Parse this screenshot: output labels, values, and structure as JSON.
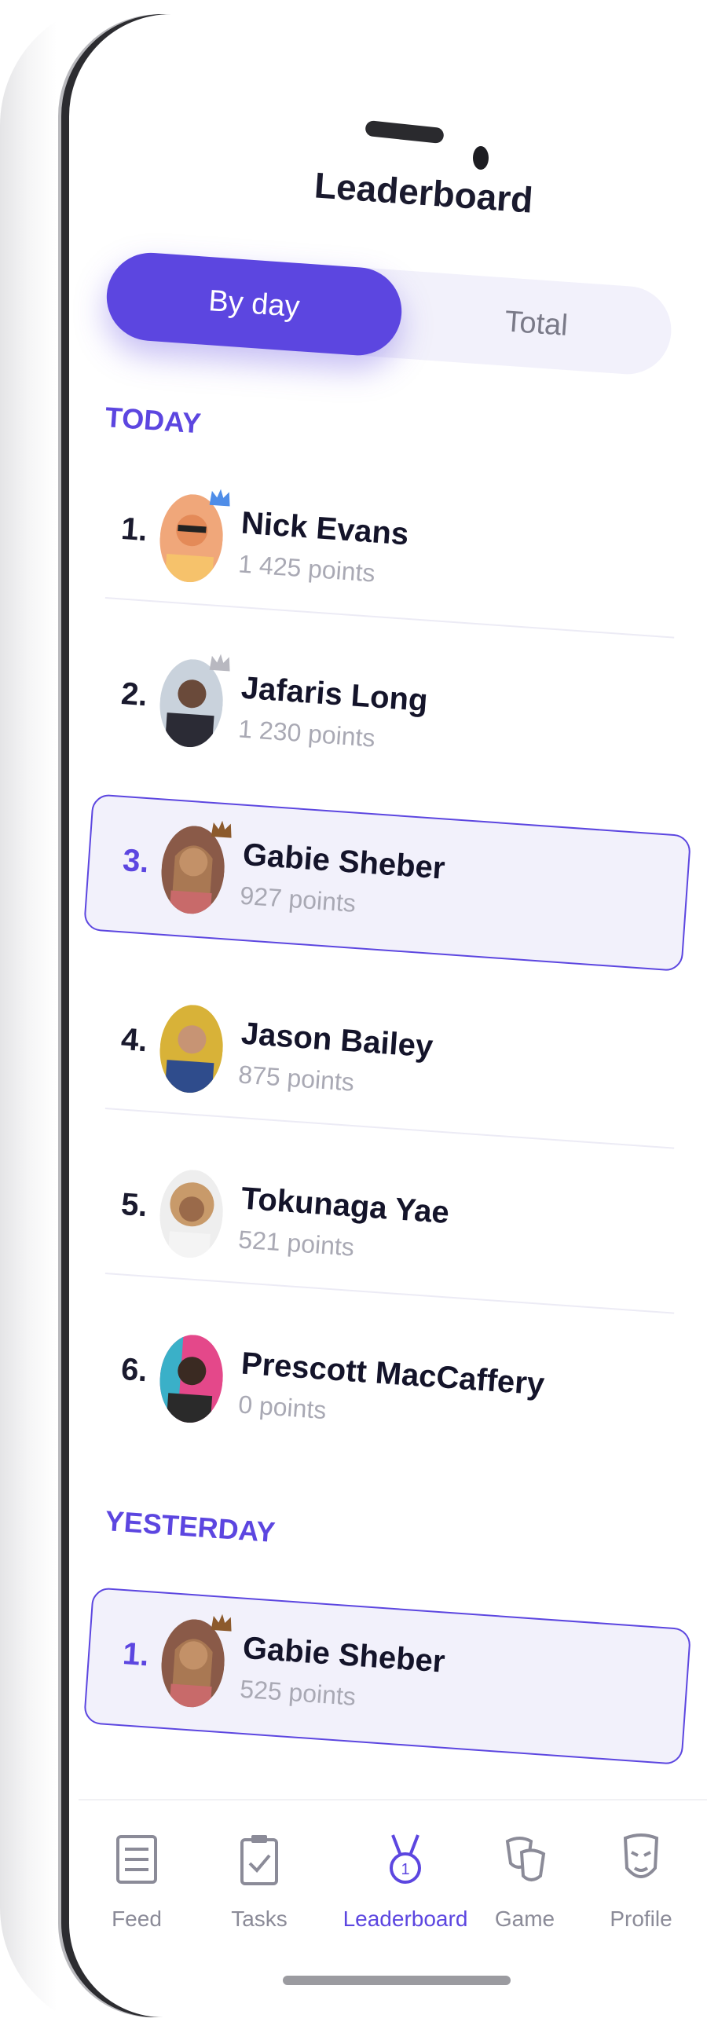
{
  "header": {
    "title": "Leaderboard"
  },
  "segmented": {
    "active": "By day",
    "inactive": "Total"
  },
  "today": {
    "label": "TODAY",
    "rows": [
      {
        "rank": "1.",
        "name": "Nick Evans",
        "points": "1 425 points",
        "crown": "blue",
        "highlight": false
      },
      {
        "rank": "2.",
        "name": "Jafaris Long",
        "points": "1 230 points",
        "crown": "silver",
        "highlight": false
      },
      {
        "rank": "3.",
        "name": "Gabie Sheber",
        "points": "927 points",
        "crown": "bronze",
        "highlight": true
      },
      {
        "rank": "4.",
        "name": "Jason Bailey",
        "points": "875 points",
        "crown": "",
        "highlight": false
      },
      {
        "rank": "5.",
        "name": "Tokunaga Yae",
        "points": "521 points",
        "crown": "",
        "highlight": false
      },
      {
        "rank": "6.",
        "name": "Prescott MacCaffery",
        "points": "0 points",
        "crown": "",
        "highlight": false
      }
    ]
  },
  "yesterday": {
    "label": "YESTERDAY",
    "rows": [
      {
        "rank": "1.",
        "name": "Gabie Sheber",
        "points": "525 points",
        "crown": "bronze",
        "highlight": true
      }
    ]
  },
  "tabbar": {
    "items": [
      {
        "label": "Feed",
        "icon": "feed-icon",
        "active": false
      },
      {
        "label": "Tasks",
        "icon": "tasks-icon",
        "active": false
      },
      {
        "label": "Leaderboard",
        "icon": "medal-icon",
        "active": true
      },
      {
        "label": "Game",
        "icon": "masks-icon",
        "active": false
      },
      {
        "label": "Profile",
        "icon": "mask-icon",
        "active": false
      }
    ]
  },
  "colors": {
    "accent": "#5c46e0",
    "highlight_bg": "#f2f1fb",
    "text": "#1a1a2e",
    "muted": "#a9a9b4"
  }
}
